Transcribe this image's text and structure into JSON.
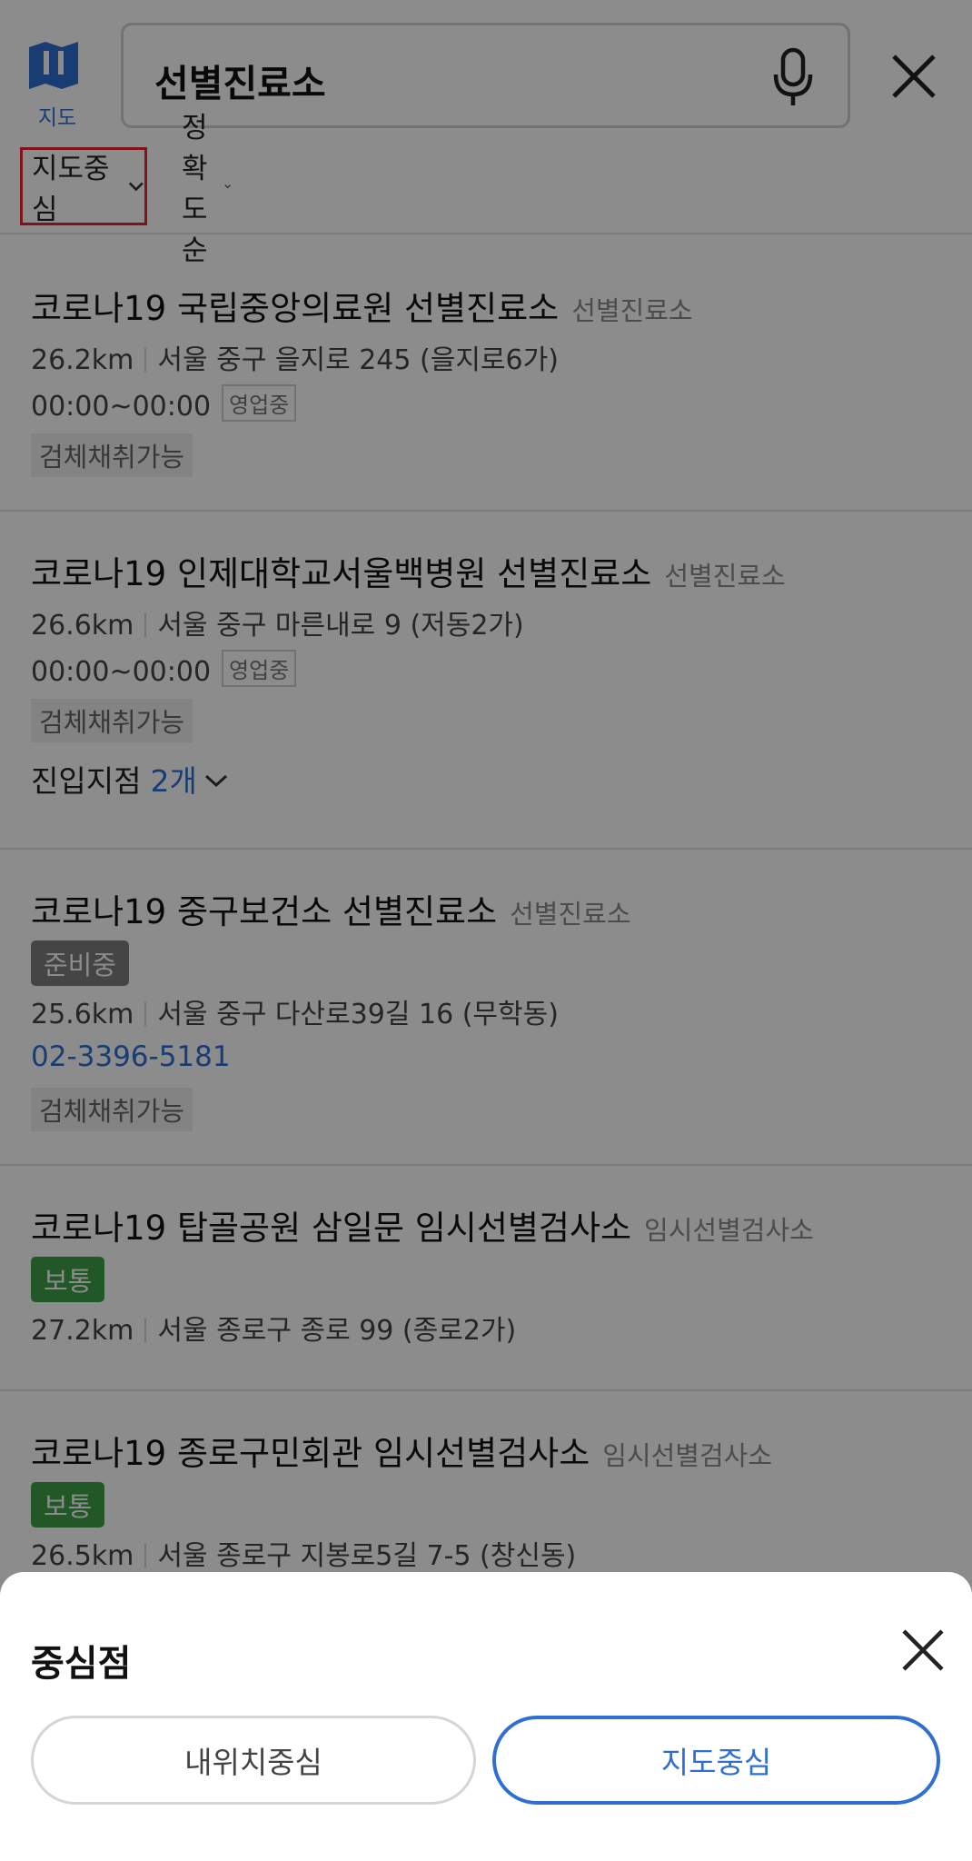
{
  "header": {
    "map_logo_label": "지도",
    "search_query": "선별진료소",
    "filter_center": "지도중심",
    "filter_sort": "정확도순"
  },
  "results": [
    {
      "name": "코로나19 국립중앙의료원 선별진료소",
      "category": "선별진료소",
      "distance": "26.2km",
      "address": "서울 중구 을지로 245 (을지로6가)",
      "hours": "00:00~00:00",
      "open_status": "영업중",
      "tag": "검체채취가능"
    },
    {
      "name": "코로나19 인제대학교서울백병원 선별진료소",
      "category": "선별진료소",
      "distance": "26.6km",
      "address": "서울 중구 마른내로 9 (저동2가)",
      "hours": "00:00~00:00",
      "open_status": "영업중",
      "tag": "검체채취가능",
      "entry_label": "진입지점",
      "entry_count": "2개"
    },
    {
      "name": "코로나19 중구보건소 선별진료소",
      "category": "선별진료소",
      "status": "준비중",
      "distance": "25.6km",
      "address": "서울 중구 다산로39길 16 (무학동)",
      "phone": "02-3396-5181",
      "tag": "검체채취가능"
    },
    {
      "name": "코로나19 탑골공원 삼일문 임시선별검사소",
      "category": "임시선별검사소",
      "status": "보통",
      "distance": "27.2km",
      "address": "서울 종로구 종로 99 (종로2가)"
    },
    {
      "name": "코로나19 종로구민회관 임시선별검사소",
      "category": "임시선별검사소",
      "status": "보통",
      "distance": "26.5km",
      "address": "서울 종로구 지봉로5길 7-5 (창신동)"
    }
  ],
  "sheet": {
    "title": "중심점",
    "option_my_location": "내위치중심",
    "option_map_center": "지도중심"
  },
  "colors": {
    "accent_blue": "#2f6fd1",
    "status_green": "#3f9f48",
    "status_gray": "#7e7e7e",
    "highlight_red": "#e8242a"
  }
}
